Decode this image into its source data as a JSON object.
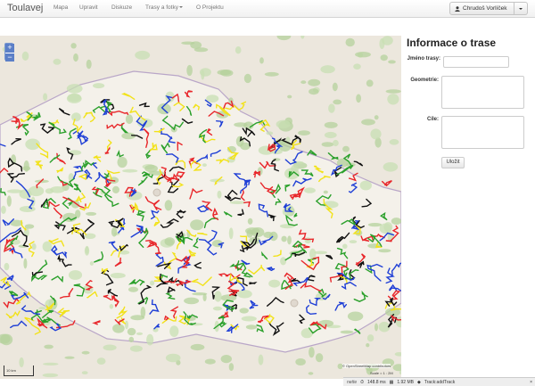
{
  "navbar": {
    "brand": "Toulavej",
    "items": [
      {
        "label": "Mapa"
      },
      {
        "label": "Upravit"
      },
      {
        "label": "Diskuze"
      },
      {
        "label": "Trasy a fotky"
      },
      {
        "label": "O Projektu"
      }
    ],
    "user": "Chrudoš Vorlíček"
  },
  "panel": {
    "title": "Informace o trase",
    "name_label": "Jméno trasy:",
    "geometry_label": "Geometrie:",
    "target_label": "Cíle:",
    "save_label": "Uložit",
    "name_value": "",
    "geometry_value": "",
    "target_value": ""
  },
  "map": {
    "zoom_in": "+",
    "zoom_out": "−",
    "attribution": "© OpenStreetMap contributors",
    "scale_label": "10 km",
    "scale_text": "Scale = 1 : 2M"
  },
  "debug": {
    "logo": "nette",
    "time": "148.8 ms",
    "memory": "1.92 MB",
    "route": "Track:addTrack",
    "close": "×"
  }
}
